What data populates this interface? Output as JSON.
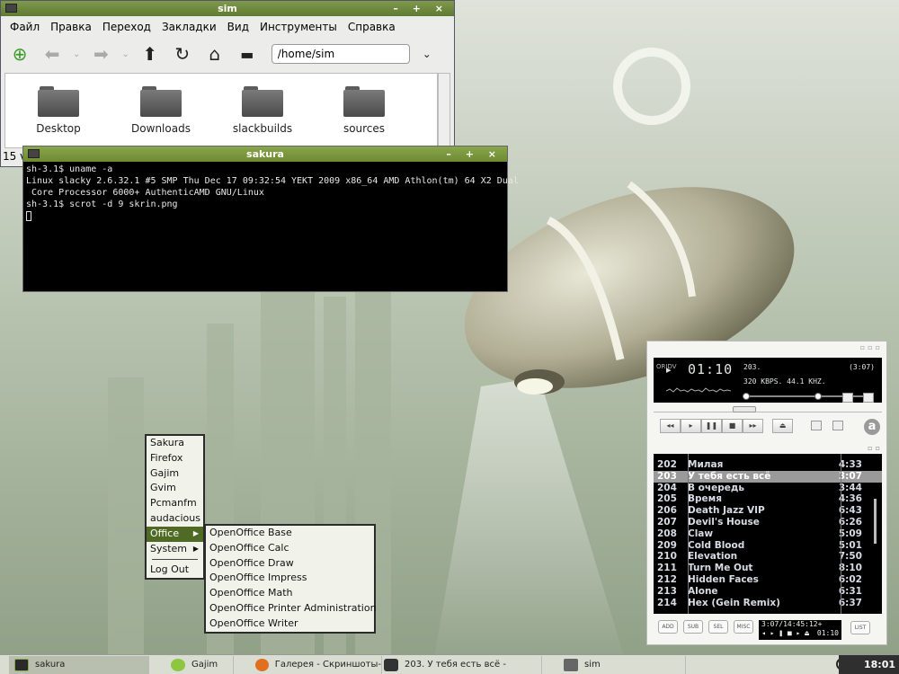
{
  "file_manager": {
    "title": "sim",
    "window_controls": "– + ×",
    "menu": [
      "Файл",
      "Правка",
      "Переход",
      "Закладки",
      "Вид",
      "Инструменты",
      "Справка"
    ],
    "location_value": "/home/sim",
    "folders": [
      "Desktop",
      "Downloads",
      "slackbuilds",
      "sources"
    ],
    "status": "15 v"
  },
  "terminal": {
    "title": "sakura",
    "window_controls": "– + ×",
    "lines": [
      "sh-3.1$ uname -a",
      "Linux slacky 2.6.32.1 #5 SMP Thu Dec 17 09:32:54 YEKT 2009 x86_64 AMD Athlon(tm) 64 X2 Dual",
      " Core Processor 6000+ AuthenticAMD GNU/Linux",
      "sh-3.1$ scrot -d 9 skrin.png"
    ]
  },
  "menu_main": {
    "items": [
      "Sakura",
      "Firefox",
      "Gajim",
      "Gvim",
      "Pcmanfm",
      "audacious",
      "Office",
      "System",
      "Log Out"
    ],
    "selected": "Office"
  },
  "menu_office": {
    "items": [
      "OpenOffice Base",
      "OpenOffice Calc",
      "OpenOffice Draw",
      "OpenOffice Impress",
      "OpenOffice Math",
      "OpenOffice Printer Administration",
      "OpenOffice Writer"
    ]
  },
  "audacious": {
    "vertical_text": "ORIDV",
    "time": "01:10",
    "track_no": "203.",
    "track_len": "(3:07)",
    "bitrate": "320 KBPS. 44.1 KHZ.",
    "buttons": [
      "◂◂",
      "▸",
      "❚❚",
      "■",
      "▸▸",
      "⏏"
    ],
    "playlist": [
      {
        "n": "202",
        "t": "Милая",
        "d": "4:33"
      },
      {
        "n": "203",
        "t": "У тебя есть всё",
        "d": "3:07"
      },
      {
        "n": "204",
        "t": "В очередь",
        "d": "3:44"
      },
      {
        "n": "205",
        "t": "Время",
        "d": "4:36"
      },
      {
        "n": "206",
        "t": "Death Jazz VIP",
        "d": "6:43"
      },
      {
        "n": "207",
        "t": "Devil's House",
        "d": "6:26"
      },
      {
        "n": "208",
        "t": "Claw",
        "d": "5:09"
      },
      {
        "n": "209",
        "t": "Cold Blood",
        "d": "5:01"
      },
      {
        "n": "210",
        "t": "Elevation",
        "d": "7:50"
      },
      {
        "n": "211",
        "t": "Turn Me Out",
        "d": "8:10"
      },
      {
        "n": "212",
        "t": "Hidden Faces",
        "d": "6:02"
      },
      {
        "n": "213",
        "t": "Alone",
        "d": "6:31"
      },
      {
        "n": "214",
        "t": "Hex (Gein Remix)",
        "d": "6:37"
      }
    ],
    "selected_index": 1,
    "bottom_buttons": [
      "ADD",
      "SUB",
      "SEL",
      "MISC"
    ],
    "total_info": "3:07/14:45:12+",
    "mini_time": "01:10",
    "list_button": "LIST",
    "logo_letter": "a"
  },
  "taskbar": {
    "tasks": [
      "sakura",
      "Gajim",
      "Галерея - Скриншоты-",
      "203. У тебя есть всё -",
      "sim"
    ],
    "clock": "18:01"
  }
}
